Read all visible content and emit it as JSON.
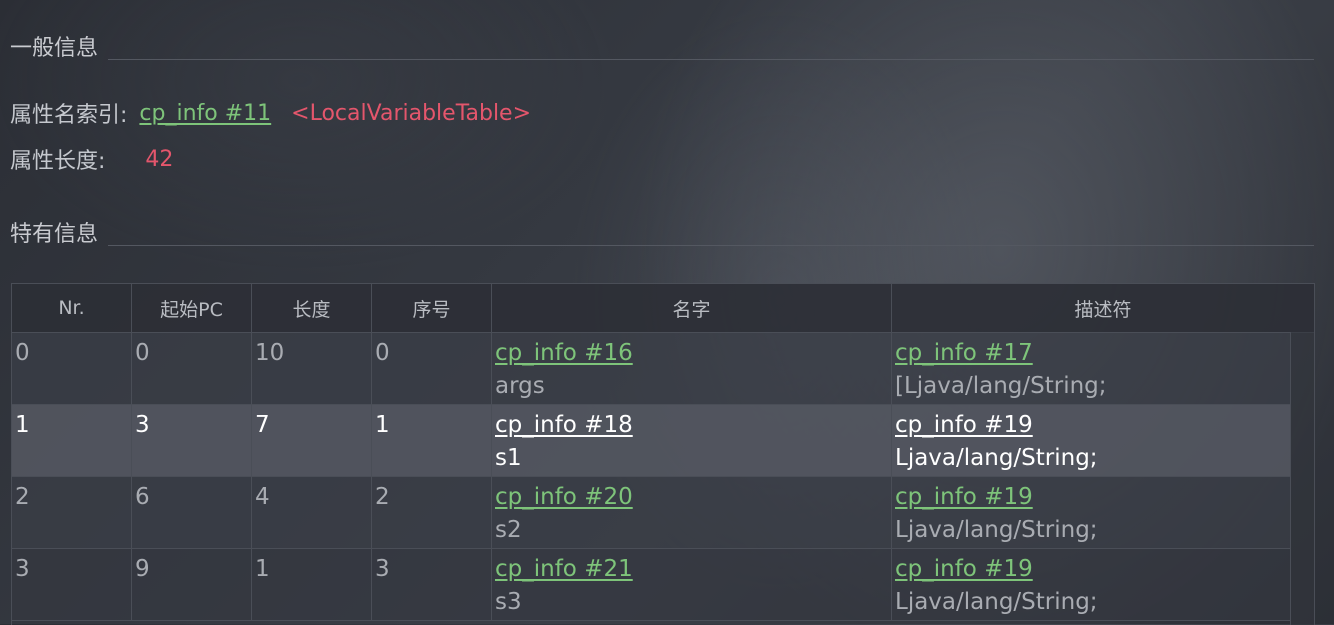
{
  "general": {
    "title": "一般信息",
    "name_index_label": "属性名索引:",
    "name_index_link": "cp_info #11",
    "name_index_value": "<LocalVariableTable>",
    "length_label": "属性长度:",
    "length_value": "42"
  },
  "specific": {
    "title": "特有信息"
  },
  "table": {
    "headers": [
      "Nr.",
      "起始PC",
      "长度",
      "序号",
      "名字",
      "描述符"
    ],
    "rows": [
      {
        "nr": "0",
        "start_pc": "0",
        "length": "10",
        "index": "0",
        "name_link": "cp_info #16",
        "name_value": "args",
        "desc_link": "cp_info #17",
        "desc_value": "[Ljava/lang/String;"
      },
      {
        "nr": "1",
        "start_pc": "3",
        "length": "7",
        "index": "1",
        "name_link": "cp_info #18",
        "name_value": "s1",
        "desc_link": "cp_info #19",
        "desc_value": "Ljava/lang/String;"
      },
      {
        "nr": "2",
        "start_pc": "6",
        "length": "4",
        "index": "2",
        "name_link": "cp_info #20",
        "name_value": "s2",
        "desc_link": "cp_info #19",
        "desc_value": "Ljava/lang/String;"
      },
      {
        "nr": "3",
        "start_pc": "9",
        "length": "1",
        "index": "3",
        "name_link": "cp_info #21",
        "name_value": "s3",
        "desc_link": "cp_info #19",
        "desc_value": "Ljava/lang/String;"
      }
    ],
    "selected_row": 1
  },
  "colors": {
    "link": "#7ec47a",
    "accent_red": "#e4566c",
    "selected_row_bg": "#52565f"
  }
}
